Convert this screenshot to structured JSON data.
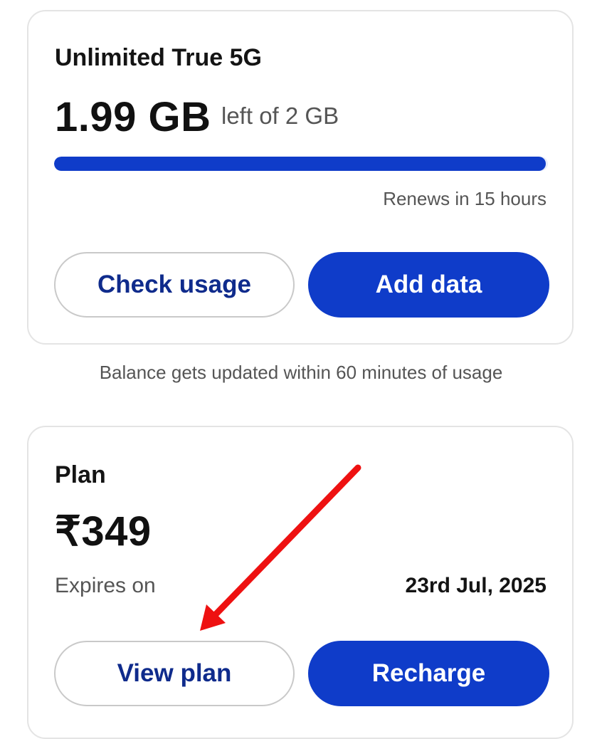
{
  "data_card": {
    "title": "Unlimited True 5G",
    "remaining": "1.99 GB",
    "remaining_suffix": "left of 2 GB",
    "usage_fraction_remaining": 0.995,
    "renews_text": "Renews in 15 hours",
    "check_usage_label": "Check usage",
    "add_data_label": "Add data"
  },
  "balance_note": "Balance gets updated within 60 minutes of usage",
  "plan_card": {
    "title": "Plan",
    "price": "₹349",
    "expires_label": "Expires on",
    "expires_date": "23rd Jul, 2025",
    "view_plan_label": "View plan",
    "recharge_label": "Recharge"
  },
  "colors": {
    "accent": "#0f3cc9",
    "outline_text": "#0f2b8c",
    "annotation_arrow": "#ee1111"
  }
}
